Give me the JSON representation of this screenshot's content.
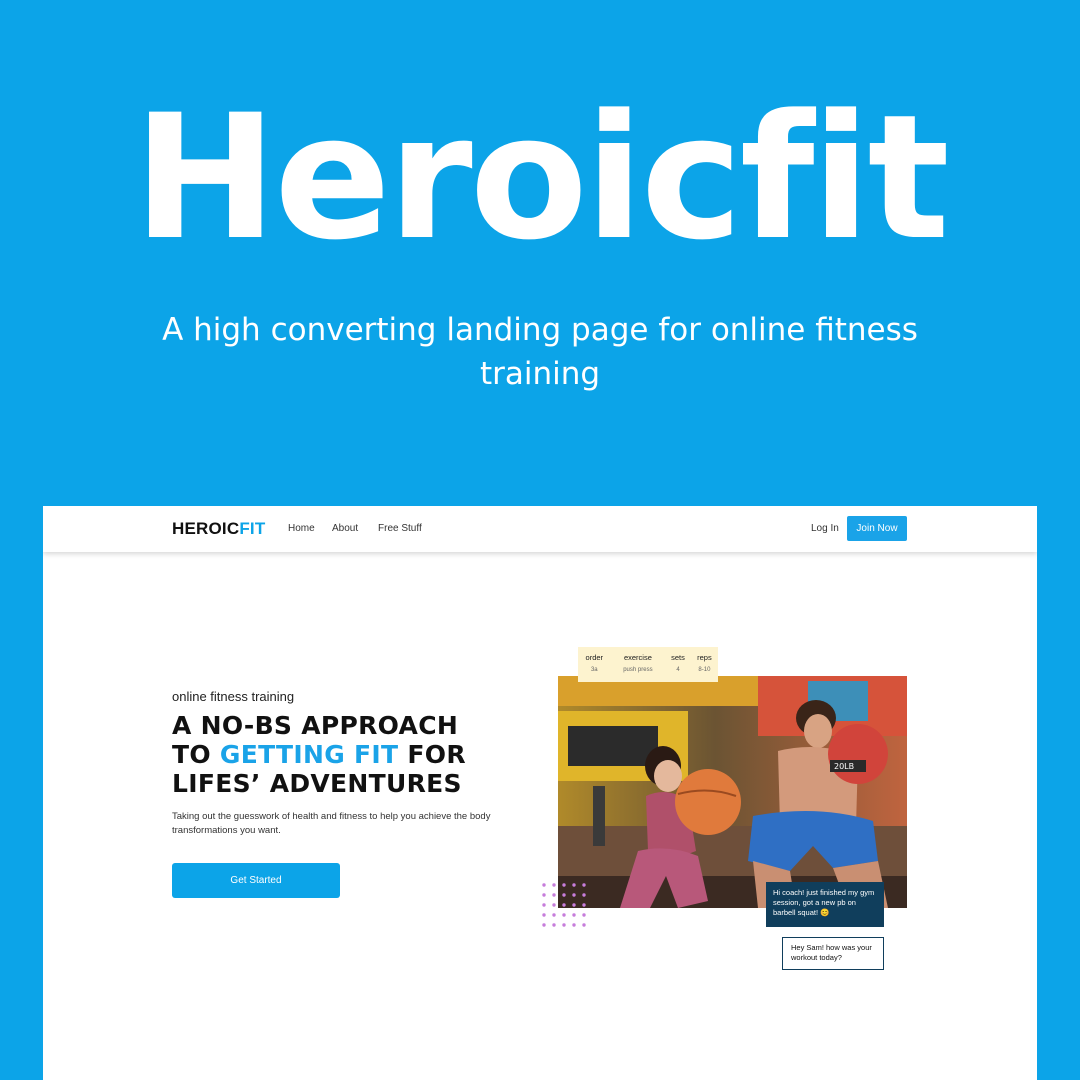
{
  "promo": {
    "title": "Heroicfit",
    "subtitle": "A high converting landing page for online fitness training"
  },
  "nav": {
    "logo_main": "HEROIC",
    "logo_accent": "FIT",
    "links": [
      "Home",
      "About",
      "Free Stuff"
    ],
    "login": "Log In",
    "join": "Join Now"
  },
  "hero": {
    "eyebrow": "online fitness training",
    "headline_line1": "A NO-BS APPROACH",
    "headline_to": "TO ",
    "headline_highlight": "GETTING FIT",
    "headline_for": " FOR",
    "headline_line3": "LIFES’ ADVENTURES",
    "description": "Taking out the guesswork of health and fitness to help you achieve the body transformations you want.",
    "cta": "Get Started"
  },
  "workout_card": {
    "headers": [
      "order",
      "exercise",
      "sets",
      "reps"
    ],
    "row": [
      "3a",
      "push press",
      "4",
      "8-10"
    ]
  },
  "chat": {
    "coach_message": "Hi coach! just finished my gym session, got a new pb on barbell squat! 😊",
    "reply_message": "Hey Sam! how was your workout today?"
  },
  "colors": {
    "brand_blue": "#0ca4e8",
    "chat_navy": "#103e5c",
    "card_yellow": "#fdf3cf",
    "dots_purple": "#c77ddb"
  }
}
